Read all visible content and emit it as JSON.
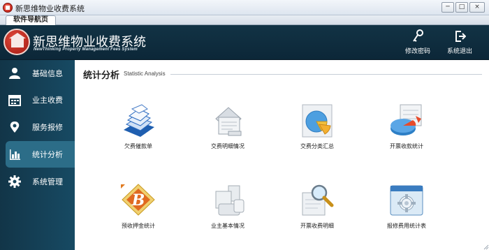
{
  "window": {
    "title": "新思维物业收费系统",
    "minimize": "─",
    "maximize": "□",
    "close": "×"
  },
  "tabs": [
    {
      "label": "软件导航页"
    }
  ],
  "header": {
    "brand_title": "新思维物业收费系统",
    "brand_subtitle": "NewThinking Property Management Fees System",
    "buttons": [
      {
        "label": "修改密码",
        "icon": "key-icon"
      },
      {
        "label": "系统退出",
        "icon": "exit-icon"
      }
    ]
  },
  "sidebar": {
    "items": [
      {
        "label": "基础信息",
        "icon": "user-icon",
        "active": false
      },
      {
        "label": "业主收费",
        "icon": "calendar-icon",
        "active": false
      },
      {
        "label": "服务报修",
        "icon": "map-pin-icon",
        "active": false
      },
      {
        "label": "统计分析",
        "icon": "bar-chart-icon",
        "active": true
      },
      {
        "label": "系统管理",
        "icon": "gear-icon",
        "active": false
      }
    ]
  },
  "main": {
    "title": "统计分析",
    "subtitle": "Statistic Analysis",
    "functions": [
      {
        "label": "欠费催款单",
        "icon": "stacked-documents-icon"
      },
      {
        "label": "交费明细情况",
        "icon": "document-icon"
      },
      {
        "label": "交费分类汇总",
        "icon": "pie-chart-icon"
      },
      {
        "label": "开票收款统计",
        "icon": "pie-chart-report-icon"
      },
      {
        "label": "预收押金统计",
        "icon": "letter-b-icon"
      },
      {
        "label": "业主基本情况",
        "icon": "owner-cards-icon"
      },
      {
        "label": "开票收费明细",
        "icon": "magnifier-document-icon"
      },
      {
        "label": "报修费用统计表",
        "icon": "gear-panel-icon"
      }
    ]
  },
  "colors": {
    "header_bg": "#0f2e40",
    "sidebar_bg": "#163f55",
    "active_item": "#2c6d88",
    "content_bg": "#ffffff"
  }
}
